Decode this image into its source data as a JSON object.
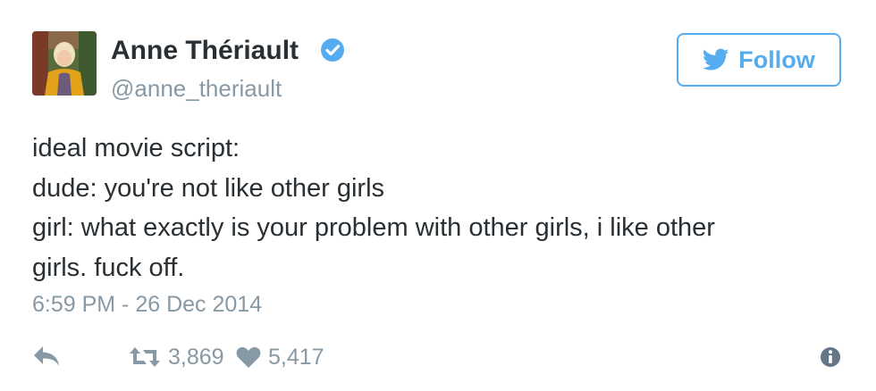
{
  "author": {
    "display_name": "Anne Thériault",
    "handle": "@anne_theriault",
    "verified": true
  },
  "follow_button": {
    "label": "Follow"
  },
  "tweet": {
    "lines": [
      "ideal movie script:",
      "dude: you're not like other girls",
      "girl: what exactly is your problem with other girls, i like other",
      "girls. fuck off."
    ],
    "timestamp": "6:59 PM - 26 Dec 2014"
  },
  "stats": {
    "retweets": "3,869",
    "likes": "5,417"
  },
  "icons": {
    "verified": "verified-badge-icon",
    "follow": "bird-icon",
    "reply": "reply-icon",
    "retweet": "retweet-icon",
    "like": "heart-icon",
    "info": "info-icon"
  },
  "colors": {
    "accent": "#55acee",
    "text": "#292f33",
    "muted": "#8899a6"
  }
}
